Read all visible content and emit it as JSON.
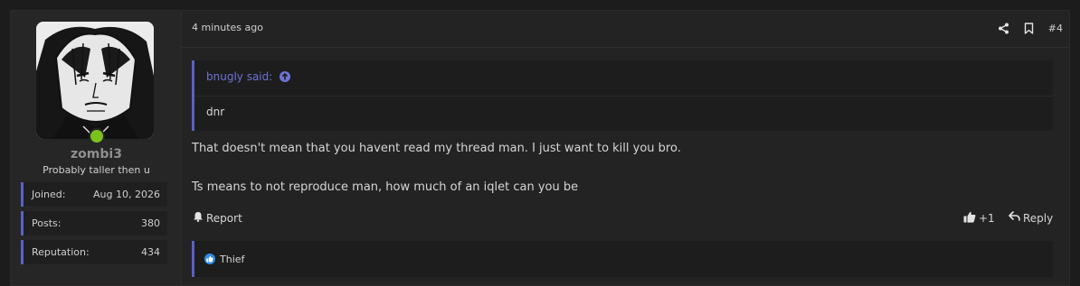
{
  "user": {
    "username": "zombi3",
    "title": "Probably taller then u",
    "stats": [
      {
        "label": "Joined:",
        "value": "Aug 10, 2026"
      },
      {
        "label": "Posts:",
        "value": "380"
      },
      {
        "label": "Reputation:",
        "value": "434"
      }
    ]
  },
  "post": {
    "time": "4 minutes ago",
    "number": "#4",
    "quote": {
      "author_line": "bnugly said:",
      "text": "dnr"
    },
    "paragraphs": [
      "That doesn't mean that you havent read my thread man. I just want to kill you bro.",
      "Ts means to not reproduce man, how much of an iqlet can you be"
    ]
  },
  "actions": {
    "report": "Report",
    "like_count": "+1",
    "reply": "Reply"
  },
  "reactions": {
    "name": "Thief"
  },
  "colors": {
    "accent": "#5b61c4",
    "quote_link": "#6c74d6",
    "online": "#7bc21b",
    "like": "#2f8ee5"
  }
}
